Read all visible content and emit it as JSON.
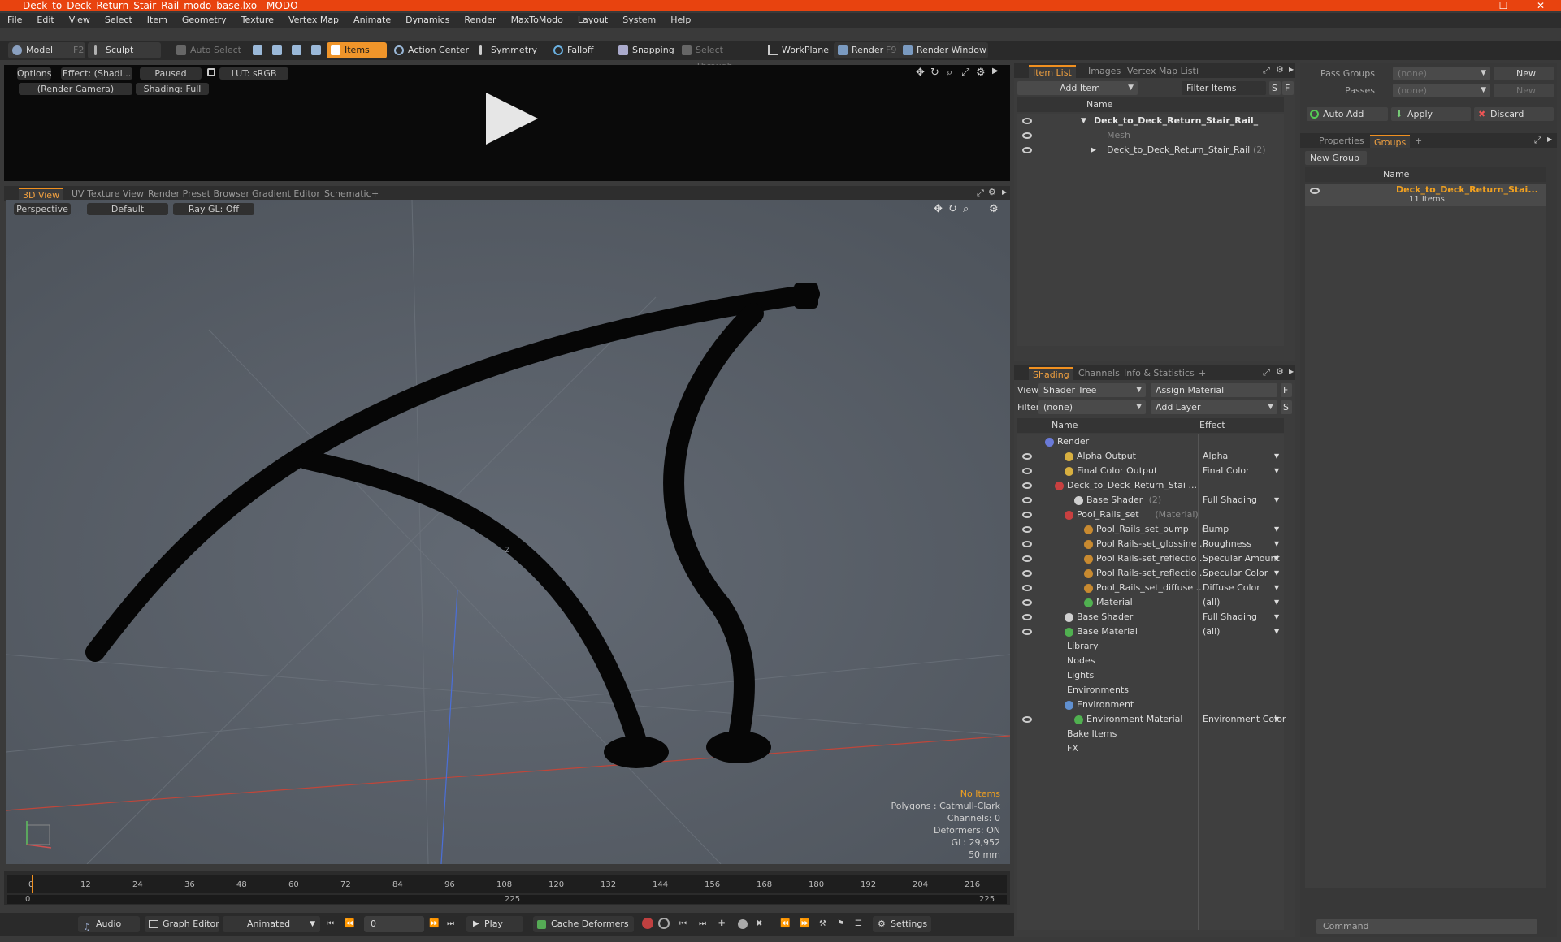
{
  "window": {
    "title": "Deck_to_Deck_Return_Stair_Rail_modo_base.lxo - MODO",
    "minimize": "—",
    "maximize": "☐",
    "close": "✕"
  },
  "menu": [
    "File",
    "Edit",
    "View",
    "Select",
    "Item",
    "Geometry",
    "Texture",
    "Vertex Map",
    "Animate",
    "Dynamics",
    "Render",
    "MaxToModo",
    "Layout",
    "System",
    "Help"
  ],
  "toolbar": {
    "model": "Model",
    "model_key": "F2",
    "sculpt": "Sculpt",
    "auto_select": "Auto Select",
    "items": "Items",
    "action_center": "Action Center",
    "symmetry": "Symmetry",
    "falloff": "Falloff",
    "snapping": "Snapping",
    "select_through": "Select Through",
    "workplane": "WorkPlane",
    "render": "Render",
    "render_key": "F9",
    "render_window": "Render Window"
  },
  "preview": {
    "options": "Options",
    "effect": "Effect: (Shadi...",
    "paused": "Paused",
    "lut": "LUT: sRGB",
    "camera": "(Render Camera)",
    "shading": "Shading: Full"
  },
  "viewtabs": {
    "t3d": "3D View",
    "uv": "UV Texture View",
    "preset": "Render Preset Browser",
    "gradient": "Gradient Editor",
    "schematic": "Schematic",
    "add": "+"
  },
  "viewport": {
    "perspective": "Perspective",
    "default": "Default",
    "raygl": "Ray GL: Off",
    "axis_label": "-Z"
  },
  "status": {
    "no_items": "No Items",
    "polygons": "Polygons : Catmull-Clark",
    "channels": "Channels: 0",
    "deformers": "Deformers: ON",
    "gl": "GL: 29,952",
    "focal": "50 mm"
  },
  "timeline": {
    "ticks": [
      "0",
      "12",
      "24",
      "36",
      "48",
      "60",
      "72",
      "84",
      "96",
      "108",
      "120",
      "132",
      "144",
      "156",
      "168",
      "180",
      "192",
      "204",
      "216"
    ],
    "start": "0",
    "mid": "225",
    "end": "225"
  },
  "bottom": {
    "audio": "Audio",
    "graph_editor": "Graph Editor",
    "animated": "Animated",
    "frame": "0",
    "play": "Play",
    "cache_deformers": "Cache Deformers",
    "settings": "Settings"
  },
  "itemlist": {
    "tabs": [
      "Item List",
      "Images",
      "Vertex Map List",
      "+"
    ],
    "add_item": "Add Item",
    "filter_items": "Filter Items",
    "s": "S",
    "f": "F",
    "col_name": "Name",
    "rows": [
      {
        "label": "Deck_to_Deck_Return_Stair_Rail_",
        "indent": 0
      },
      {
        "label": "Mesh",
        "indent": 1
      },
      {
        "label": "Deck_to_Deck_Return_Stair_Rail",
        "count": "(2)",
        "indent": 1
      }
    ]
  },
  "shading": {
    "tabs": [
      "Shading",
      "Channels",
      "Info & Statistics",
      "+"
    ],
    "view_label": "View",
    "view_value": "Shader Tree",
    "assign": "Assign Material",
    "f": "F",
    "filter_label": "Filter",
    "filter_value": "(none)",
    "add_layer": "Add Layer",
    "s": "S",
    "col_name": "Name",
    "col_effect": "Effect",
    "rows": [
      {
        "name": "Render",
        "effect": "",
        "ind": 0,
        "eye": false,
        "c": "#6a7ad8"
      },
      {
        "name": "Alpha Output",
        "effect": "Alpha",
        "ind": 2,
        "eye": true,
        "c": "#d8b040"
      },
      {
        "name": "Final Color Output",
        "effect": "Final Color",
        "ind": 2,
        "eye": true,
        "c": "#d8b040"
      },
      {
        "name": "Deck_to_Deck_Return_Stai ...",
        "effect": "",
        "ind": 1,
        "eye": true,
        "c": "#c84040"
      },
      {
        "name": "Base Shader",
        "extra": "(2)",
        "effect": "Full Shading",
        "ind": 3,
        "eye": true,
        "c": "#d0d0d0"
      },
      {
        "name": "Pool_Rails_set",
        "extra": "(Material)",
        "effect": "",
        "ind": 2,
        "eye": true,
        "c": "#c84040"
      },
      {
        "name": "Pool_Rails_set_bump",
        "extra": "( ...",
        "effect": "Bump",
        "ind": 4,
        "eye": true,
        "c": "#c88a30"
      },
      {
        "name": "Pool Rails-set_glossine ...",
        "effect": "Roughness",
        "ind": 4,
        "eye": true,
        "c": "#c88a30"
      },
      {
        "name": "Pool Rails-set_reflectio ...",
        "effect": "Specular Amount",
        "ind": 4,
        "eye": true,
        "c": "#c88a30"
      },
      {
        "name": "Pool Rails-set_reflectio ...",
        "effect": "Specular Color",
        "ind": 4,
        "eye": true,
        "c": "#c88a30"
      },
      {
        "name": "Pool_Rails_set_diffuse ...",
        "effect": "Diffuse Color",
        "ind": 4,
        "eye": true,
        "c": "#c88a30"
      },
      {
        "name": "Material",
        "effect": "(all)",
        "ind": 4,
        "eye": true,
        "c": "#50b050"
      },
      {
        "name": "Base Shader",
        "effect": "Full Shading",
        "ind": 2,
        "eye": true,
        "c": "#d0d0d0"
      },
      {
        "name": "Base Material",
        "effect": "(all)",
        "ind": 2,
        "eye": true,
        "c": "#50b050"
      },
      {
        "name": "Library",
        "effect": "",
        "ind": 1,
        "eye": false,
        "c": ""
      },
      {
        "name": "Nodes",
        "effect": "",
        "ind": 1,
        "eye": false,
        "c": ""
      },
      {
        "name": "Lights",
        "effect": "",
        "ind": 1,
        "eye": false,
        "c": ""
      },
      {
        "name": "Environments",
        "effect": "",
        "ind": 1,
        "eye": false,
        "c": ""
      },
      {
        "name": "Environment",
        "effect": "",
        "ind": 2,
        "eye": false,
        "c": "#6090d0"
      },
      {
        "name": "Environment Material",
        "effect": "Environment Color",
        "ind": 3,
        "eye": true,
        "c": "#50b050"
      },
      {
        "name": "Bake Items",
        "effect": "",
        "ind": 1,
        "eye": false,
        "c": ""
      },
      {
        "name": "FX",
        "effect": "",
        "ind": 1,
        "eye": false,
        "c": ""
      }
    ]
  },
  "groups": {
    "pass_groups": "Pass Groups",
    "passes": "Passes",
    "none": "(none)",
    "new": "New",
    "auto_add": "Auto Add",
    "apply": "Apply",
    "discard": "Discard",
    "tabs": [
      "Properties",
      "Groups",
      "+"
    ],
    "new_group": "New Group",
    "col_name": "Name",
    "group_name": "Deck_to_Deck_Return_Stai...",
    "group_count": "11 Items",
    "command": "Command"
  }
}
